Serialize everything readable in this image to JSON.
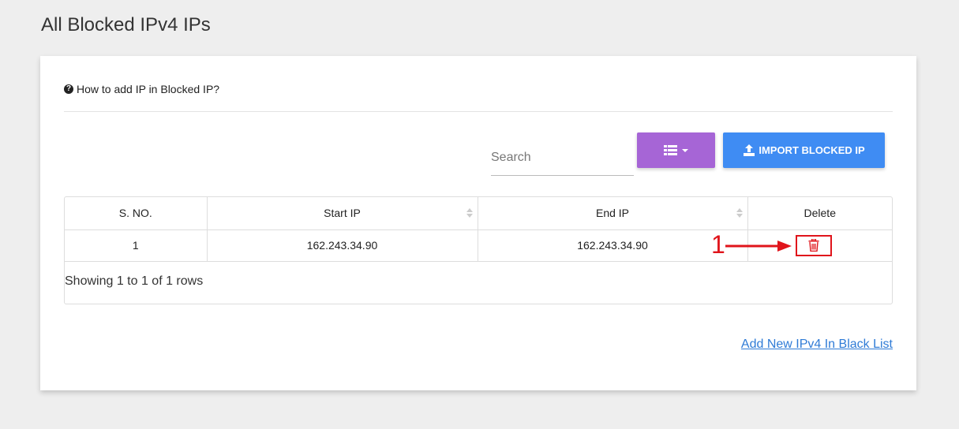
{
  "page": {
    "title": "All Blocked IPv4 IPs"
  },
  "help": {
    "label": "How to add IP in Blocked IP?",
    "icon": "question-circle-icon"
  },
  "toolbar": {
    "search_placeholder": "Search",
    "columns_icon": "list-icon",
    "import_label": "IMPORT BLOCKED IP",
    "import_icon": "upload-icon"
  },
  "table": {
    "columns": [
      {
        "label": "S. NO.",
        "sortable": false
      },
      {
        "label": "Start IP",
        "sortable": true
      },
      {
        "label": "End IP",
        "sortable": true
      },
      {
        "label": "Delete",
        "sortable": false
      }
    ],
    "rows": [
      {
        "sno": "1",
        "start_ip": "162.243.34.90",
        "end_ip": "162.243.34.90",
        "delete_icon": "trash-icon"
      }
    ],
    "pagination_info": "Showing 1 to 1 of 1 rows"
  },
  "annotation": {
    "number": "1"
  },
  "footer": {
    "add_link": "Add New IPv4 In Black List"
  },
  "colors": {
    "columns_button": "#a665d6",
    "import_button": "#3f8cf3",
    "annotation": "#e0141b",
    "link": "#2f7bd6"
  }
}
